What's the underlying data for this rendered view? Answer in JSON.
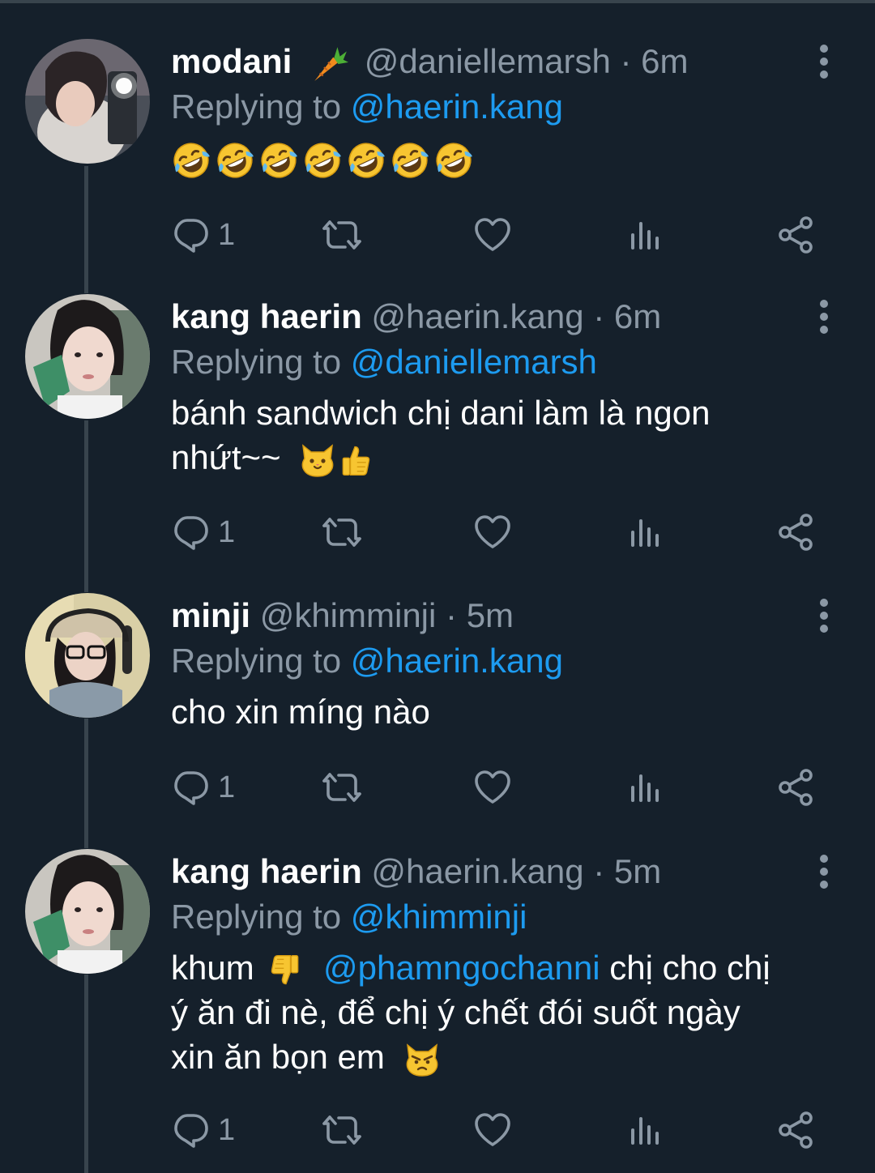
{
  "colors": {
    "background": "#15202b",
    "divider": "#38444d",
    "text_primary": "#ffffff",
    "text_secondary": "#8b98a5",
    "accent": "#1d9bf0"
  },
  "tweets": [
    {
      "name": "modani",
      "name_emoji": "carrot",
      "handle": "@daniellemarsh",
      "separator": "·",
      "time": "6m",
      "replying_label": "Replying to",
      "replying_to": "@haerin.kang",
      "body_emojis": [
        "rolling-on-floor-laughing",
        "rolling-on-floor-laughing",
        "rolling-on-floor-laughing",
        "rolling-on-floor-laughing",
        "rolling-on-floor-laughing",
        "rolling-on-floor-laughing",
        "rolling-on-floor-laughing"
      ],
      "reply_count": "1"
    },
    {
      "name": "kang haerin",
      "handle": "@haerin.kang",
      "separator": "·",
      "time": "6m",
      "replying_label": "Replying to",
      "replying_to": "@daniellemarsh",
      "body_line1": "bánh sandwich chị dani làm là ngon",
      "body_line2": "nhứt~~",
      "body_emojis": [
        "cat-face",
        "thumbs-up"
      ],
      "reply_count": "1"
    },
    {
      "name": "minji",
      "handle": "@khimminji",
      "separator": "·",
      "time": "5m",
      "replying_label": "Replying to",
      "replying_to": "@haerin.kang",
      "body": "cho xin míng nào",
      "reply_count": "1"
    },
    {
      "name": "kang haerin",
      "handle": "@haerin.kang",
      "separator": "·",
      "time": "5m",
      "replying_label": "Replying to",
      "replying_to": "@khimminji",
      "body_part1": "khum",
      "body_emoji1": "thumbs-down",
      "body_mention": "@phamngochanni",
      "body_part2": "chị cho chị",
      "body_line2": "ý ăn đi nè, để chị ý chết đói suốt ngày",
      "body_line3": "xin ăn bọn em",
      "body_emoji2": "pouting-cat",
      "reply_count": "1"
    }
  ]
}
